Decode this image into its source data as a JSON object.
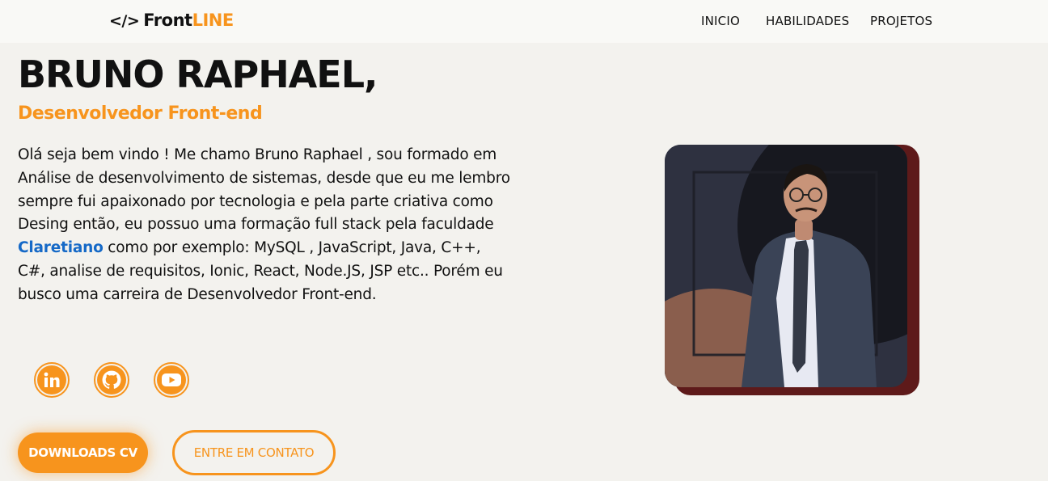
{
  "logo": {
    "code": "</>",
    "main": "Front",
    "accent": "LINE"
  },
  "nav": {
    "items": [
      "INICIO",
      "HABILIDADES",
      "PROJETOS"
    ]
  },
  "hero": {
    "name": "BRUNO RAPHAEL,",
    "role": "Desenvolvedor Front-end",
    "bio_part1": "Olá seja bem vindo ! Me chamo Bruno Raphael , sou formado em Análise de desenvolvimento de sistemas, desde que eu me lembro sempre fui apaixonado por tecnologia e pela parte criativa como Desing então, eu possuo uma formação full stack pela faculdade ",
    "bio_highlight": "Claretiano",
    "bio_part2": " como por exemplo: MySQL , JavaScript, Java, C++, C#, analise de requisitos, Ionic, React, Node.JS, JSP etc.. Porém eu busco uma carreira de Desenvolvedor Front-end."
  },
  "socials": [
    {
      "icon": "linkedin-icon"
    },
    {
      "icon": "github-icon"
    },
    {
      "icon": "youtube-icon"
    }
  ],
  "buttons": {
    "download": "DOWNLOADS CV",
    "contact": "ENTRE EM CONTATO"
  },
  "colors": {
    "accent": "#f7941d",
    "highlight": "#1569c7",
    "background": "#f3f2ee",
    "photo_frame": "#5e1a1a"
  }
}
